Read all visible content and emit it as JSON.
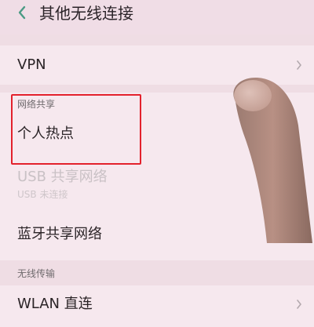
{
  "header": {
    "back_icon": "chevron-left-icon",
    "title": "其他无线连接"
  },
  "vpn": {
    "label": "VPN",
    "chevron_icon": "chevron-right-icon"
  },
  "sharing": {
    "section_label": "网络共享",
    "hotspot_label": "个人热点",
    "usb_label": "USB 共享网络",
    "usb_status": "USB 未连接",
    "bluetooth_label": "蓝牙共享网络",
    "bluetooth_enabled": false
  },
  "wireless": {
    "section_label": "无线传输",
    "wlan_direct_label": "WLAN 直连",
    "chevron_icon": "chevron-right-icon"
  },
  "colors": {
    "background": "#efdde4",
    "highlight": "#e3212c"
  }
}
